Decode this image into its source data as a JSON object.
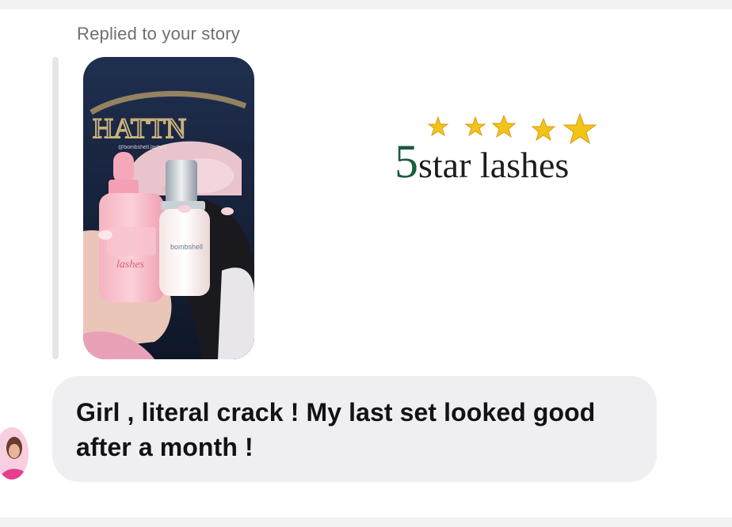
{
  "reply_context": {
    "label": "Replied to your story"
  },
  "story": {
    "overlay_handle": "@bombshell.lashes",
    "dropper_bottle_label": "bombshell"
  },
  "logo": {
    "numeral": "5",
    "text": "star lashes",
    "star_count": 5
  },
  "message": {
    "text": "Girl , literal crack ! My last set looked good after a month !"
  },
  "colors": {
    "bubble_bg": "#efeff1",
    "logo_green": "#1c5b3e",
    "star_gold": "#f2c418",
    "label_gray": "#6f6f73"
  }
}
